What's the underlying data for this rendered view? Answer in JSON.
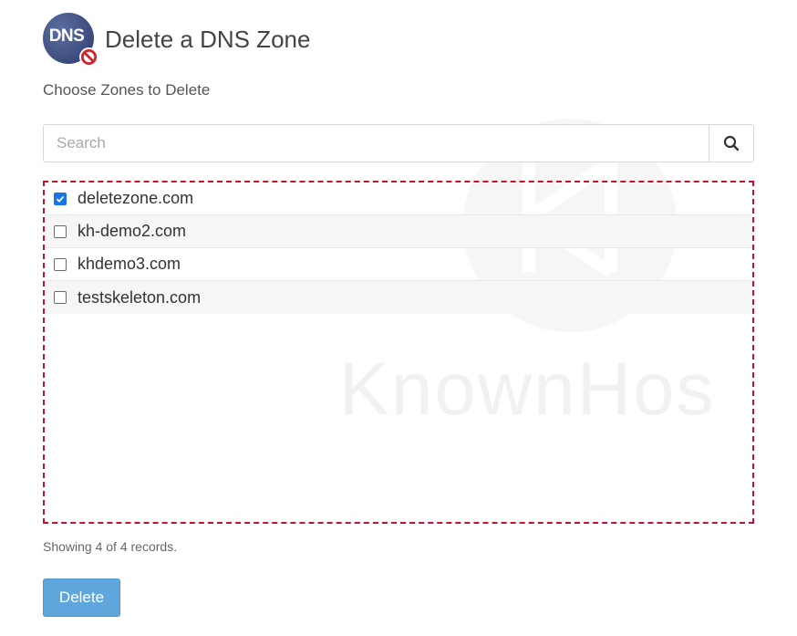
{
  "header": {
    "logo_text": "DNS",
    "title": "Delete a DNS Zone"
  },
  "subtitle": "Choose Zones to Delete",
  "search": {
    "placeholder": "Search",
    "value": ""
  },
  "zones": [
    {
      "label": "deletezone.com",
      "checked": true
    },
    {
      "label": "kh-demo2.com",
      "checked": false
    },
    {
      "label": "khdemo3.com",
      "checked": false
    },
    {
      "label": "testskeleton.com",
      "checked": false
    }
  ],
  "status": "Showing 4 of 4 records.",
  "delete_button": "Delete",
  "watermark": "KnownHos",
  "colors": {
    "accent": "#5ea6dc",
    "highlight_border": "#c8102e",
    "checkbox_checked": "#1a73e8"
  }
}
